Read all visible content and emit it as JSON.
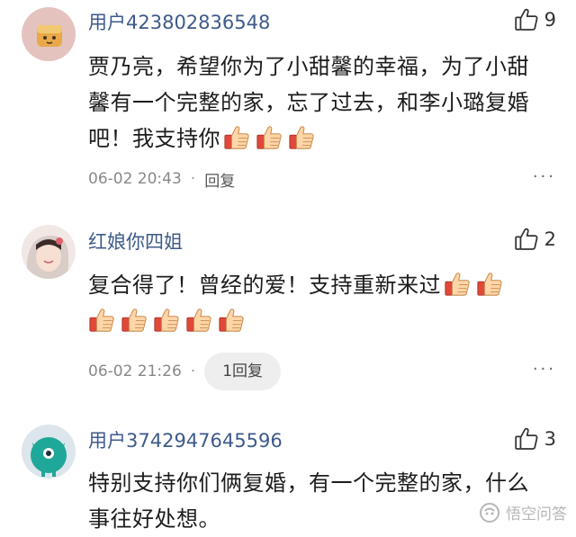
{
  "comments": [
    {
      "username": "用户423802836548",
      "likes": "9",
      "text_lines": [
        "贾乃亮，希望你为了小甜馨的幸福，为了小甜",
        "馨有一个完整的家，忘了过去，和李小璐复婚",
        "吧！我支持你"
      ],
      "line3_thumbs": 3,
      "time": "06-02 20:43",
      "reply_label": "回复"
    },
    {
      "username": "红娘你四姐",
      "likes": "2",
      "text_lines": [
        "复合得了！曾经的爱！支持重新来过"
      ],
      "line1_thumbs": 2,
      "line2_thumbs": 5,
      "time": "06-02 21:26",
      "reply_label": "1回复"
    },
    {
      "username": "用户3742947645596",
      "likes": "3",
      "text_lines": [
        "特别支持你们俩复婚，有一个完整的家，什么",
        "事往好处想。"
      ]
    }
  ],
  "more_label": "···",
  "meta_separator": "·",
  "watermark": "悟空问答",
  "icons": {
    "like": "thumbs-up-outline-icon",
    "inline": "thumbs-up-emoji-icon",
    "more": "ellipsis-icon"
  },
  "colors": {
    "username": "#3d5a8a",
    "meta": "#888888",
    "pill": "#eeeeee"
  }
}
